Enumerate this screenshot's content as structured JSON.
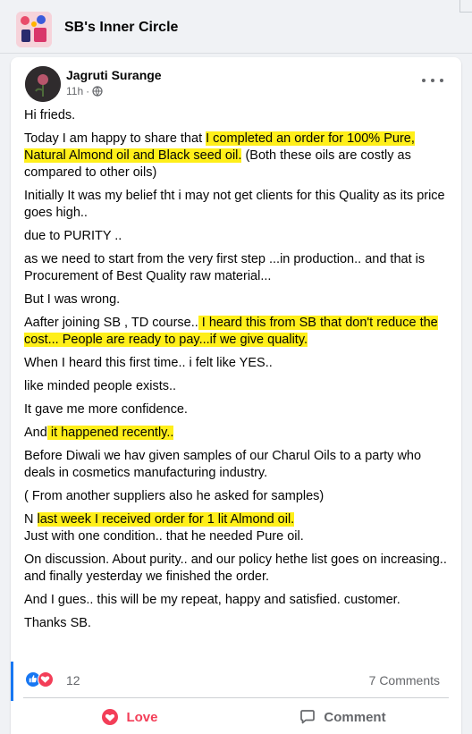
{
  "group": {
    "name": "SB's Inner Circle"
  },
  "post": {
    "author": "Jagruti Surange",
    "time": "11h",
    "privacy_icon": "globe-icon",
    "more_icon": "more-options-icon",
    "paragraphs": [
      [
        {
          "t": "Hi frieds.",
          "h": false
        }
      ],
      [
        {
          "t": "Today  I am happy to share that ",
          "h": false
        },
        {
          "t": "I completed an order for 100% Pure, Natural Almond oil and Black seed oil.",
          "h": true
        },
        {
          "t": " (Both these oils are costly as compared  to  other oils)",
          "h": false
        }
      ],
      [
        {
          "t": "Initially It was my belief tht i may not get clients for this Quality as its price goes high..",
          "h": false
        }
      ],
      [
        {
          "t": " due to PURITY ..",
          "h": false
        }
      ],
      [
        {
          "t": " as we need to start from the very first step ...in production.. and that is Procurement of Best Quality raw material...",
          "h": false
        }
      ],
      [
        {
          "t": "But I was wrong.",
          "h": false
        }
      ],
      [
        {
          "t": "Aafter joining SB , TD course..",
          "h": false
        },
        {
          "t": "  I heard this from SB that don't reduce the cost... People are ready to pay...if we give quality.   ",
          "h": true
        }
      ],
      [
        {
          "t": "When I heard this first time.. i felt like YES..",
          "h": false
        }
      ],
      [
        {
          "t": "like minded people exists..",
          "h": false
        }
      ],
      [
        {
          "t": "It gave me more confidence.",
          "h": false
        }
      ],
      [
        {
          "t": "And",
          "h": false
        },
        {
          "t": " it happened recently..",
          "h": true
        }
      ],
      [
        {
          "t": "Before Diwali we hav given  samples of our Charul Oils to a party who deals in cosmetics manufacturing industry.",
          "h": false
        }
      ],
      [
        {
          "t": "( From another suppliers also he asked for samples)",
          "h": false
        }
      ],
      [
        {
          "t": "N ",
          "h": false
        },
        {
          "t": " last week I received order for 1 lit Almond oil.",
          "h": true
        },
        {
          "t": "\nJust with one condition.. that he needed Pure oil.",
          "h": false
        }
      ],
      [
        {
          "t": "On discussion. About purity.. and our policy hethe list goes on increasing.. and finally yesterday we finished the order.",
          "h": false
        }
      ],
      [
        {
          "t": "And  I gues.. this will be my repeat, happy and satisfied.  customer.",
          "h": false
        }
      ],
      [
        {
          "t": "Thanks SB.",
          "h": false
        }
      ]
    ],
    "highlight_color": "#ffef1a"
  },
  "stats": {
    "reaction_icons": [
      "like-icon",
      "love-icon"
    ],
    "reaction_count": "12",
    "comments": "7 Comments"
  },
  "actions": {
    "love_label": "Love",
    "comment_label": "Comment"
  },
  "colors": {
    "love": "#f33e58",
    "like": "#1877f2",
    "muted": "#65676b"
  }
}
